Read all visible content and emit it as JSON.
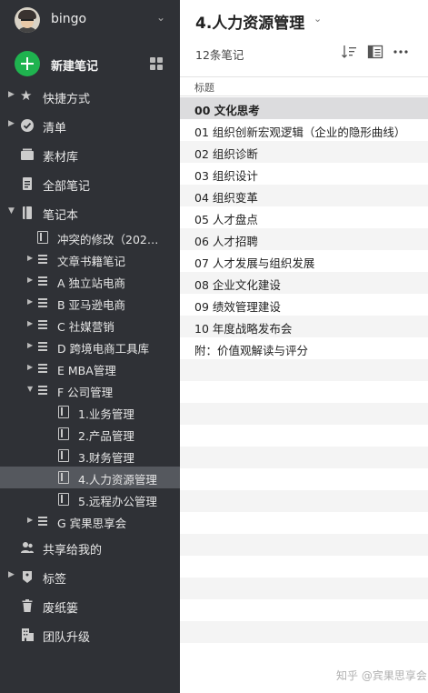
{
  "user": {
    "name": "bingo"
  },
  "new_note": {
    "label": "新建笔记"
  },
  "nav": {
    "shortcuts": "快捷方式",
    "checklist": "清单",
    "materials": "素材库",
    "all_notes": "全部笔记",
    "notebooks": "笔记本",
    "shared": "共享给我的",
    "tags": "标签",
    "trash": "废纸篓",
    "team_upgrade": "团队升级"
  },
  "tree": [
    "冲突的修改（202…",
    "文章书籍笔记",
    "A 独立站电商",
    "B 亚马逊电商",
    "C 社媒营销",
    "D 跨境电商工具库",
    "E MBA管理",
    "F 公司管理",
    "1.业务管理",
    "2.产品管理",
    "3.财务管理",
    "4.人力资源管理",
    "5.远程办公管理",
    "G 宾果思享会"
  ],
  "main": {
    "title": "4.人力资源管理",
    "note_count": "12条笔记",
    "column_title": "标题",
    "notes": [
      "00 文化思考",
      "01 组织创新宏观逻辑（企业的隐形曲线）",
      "02 组织诊断",
      "03 组织设计",
      "04 组织变革",
      "05 人才盘点",
      "06 人才招聘",
      "07 人才发展与组织发展",
      "08 企业文化建设",
      "09 绩效管理建设",
      "10 年度战略发布会",
      "附：价值观解读与评分"
    ]
  },
  "watermark": "知乎 @宾果思享会",
  "colors": {
    "sidebar_bg": "#2f3136",
    "sidebar_selected": "#55585e",
    "accent_green": "#1fb34f",
    "list_selected": "#dcdcde"
  }
}
